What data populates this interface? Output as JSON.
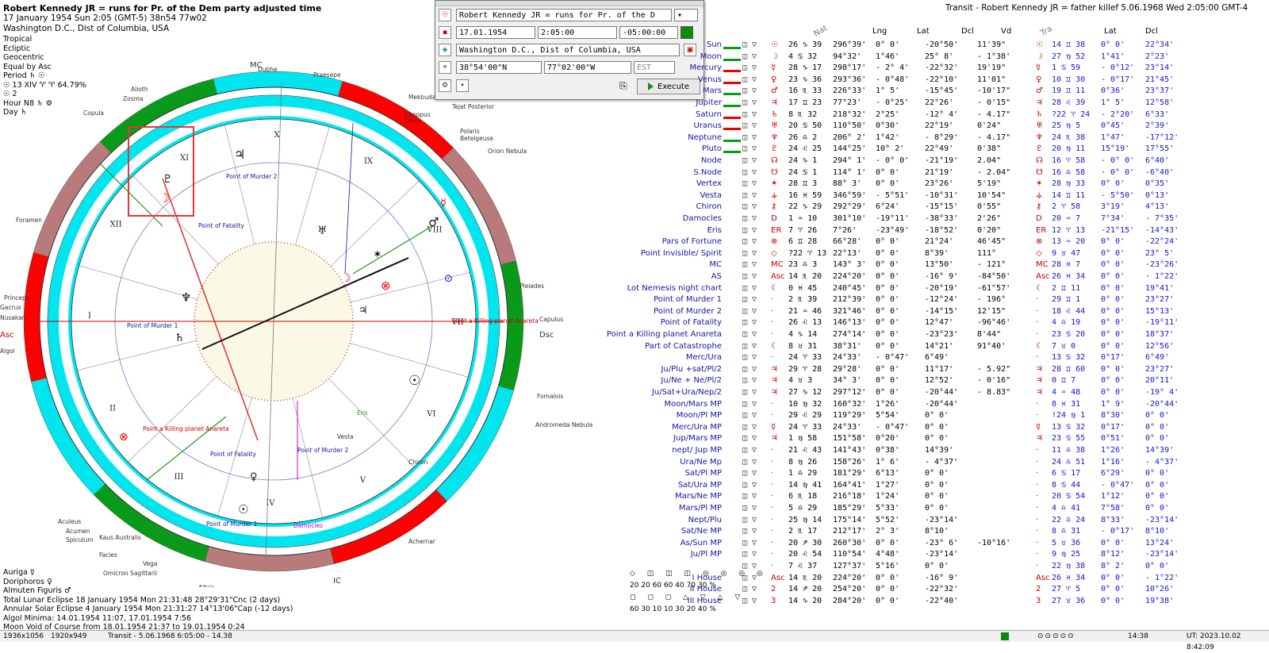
{
  "chart_header": {
    "title": "Robert Kennedy JR = runs for Pr. of the Dem party adjusted time",
    "datetime": "17 January 1954  Sun   2:05 (GMT-5) 38n54  77w02",
    "place": "Washington D.C., Dist of Columbia, USA"
  },
  "settings": [
    "Tropical",
    "Ecliptic",
    "Geocentric",
    "Equal by Asc",
    "Period ♄ ☉",
    "☉ 13 XIV ♈ ♈ 64.79%",
    "☉  2",
    "Hour N8 ♄ ⚙",
    "Day ♄"
  ],
  "transit_title": "Transit - Robert Kennedy JR = father killef  5.06.1968  Wed  2:05:00 GMT-4",
  "dialog": {
    "name_value": "Robert Kennedy JR = runs for Pr. of the D",
    "date_value": "17.01.1954",
    "time_value": "2:05:00",
    "offset_value": "-05:00:00",
    "place_value": "Washington D.C., Dist of Columbia, USA",
    "lat_value": "38°54'00\"N",
    "lon_value": "77°02'00\"W",
    "tz_value": "EST",
    "execute_label": "Execute"
  },
  "wheel": {
    "angles": {
      "mc": "MC",
      "ic": "IC",
      "asc": "Asc",
      "dsc": "Dsc"
    },
    "houses": [
      "I",
      "II",
      "III",
      "IV",
      "V",
      "VI",
      "VII",
      "VIII",
      "IX",
      "X",
      "XI",
      "XII"
    ],
    "labels": [
      "Point of Murder 2",
      "Point of Fatality",
      "Point of Murder 1",
      "Point a Killing planet Anareta",
      "Point a Killing planet Anareta",
      "Point of Murder 1",
      "Point of Murder 2",
      "Point of Fatality",
      "Damocles",
      "Vesta",
      "Chiron",
      "Eris",
      "Praesepe",
      "Polaris",
      "Betelgeuse",
      "Orion Nebula",
      "Tejat Posterior",
      "Pleiades",
      "Capulus",
      "Fomalois",
      "Andromeda Nebula",
      "Achernar",
      "Altair",
      "Vega",
      "Omicron Sagittarii",
      "Facies",
      "Kaus Australis",
      "Aculeus",
      "Acumen",
      "Spiculum",
      "Foramen",
      "Princeps",
      "Gacrux",
      "Nusakan",
      "Copula",
      "Zosma",
      "Alioth",
      "Dubhe",
      "Mekbuda",
      "Canopus",
      "Sirius",
      "Algol"
    ]
  },
  "table": {
    "headers": {
      "nat": "Nat",
      "lng": "Lng",
      "lat": "Lat",
      "dcl": "Dcl",
      "vd": "Vd",
      "tra": "Tra",
      "tlat": "Lat",
      "tdcl": "Dcl"
    },
    "rows": [
      {
        "name": "Sun",
        "sym": "☉",
        "pos": "26 ♑ 39",
        "lng": "296°39'",
        "lat": "0° 0'",
        "dcl": "-20°50'",
        "vd": "11'39\"",
        "tsym": "☉",
        "tpos": "14 ♊ 38",
        "tlat": "0° 0'",
        "tdcl": "22°34'"
      },
      {
        "name": "Moon",
        "sym": "☽",
        "pos": "4 ♋ 32",
        "lng": "94°32'",
        "lat": "1°46'",
        "dcl": "25° 8'",
        "vd": "- 1°38'",
        "tsym": "☽",
        "tpos": "27 ♍ 52",
        "tlat": "1°41'",
        "tdcl": "2°23'"
      },
      {
        "name": "Mercury",
        "sym": "☿",
        "pos": "28 ♑ 17",
        "lng": "298°17'",
        "lat": "- 2° 4'",
        "dcl": "-22°32'",
        "vd": "19'19\"",
        "tsym": "☿",
        "tpos": "1 ♋ 59",
        "tlat": "- 0°12'",
        "tdcl": "23°14'"
      },
      {
        "name": "Venus",
        "sym": "♀",
        "pos": "23 ♑ 36",
        "lng": "293°36'",
        "lat": "- 0°48'",
        "dcl": "-22°10'",
        "vd": "11'01\"",
        "tsym": "♀",
        "tpos": "10 ♊ 30",
        "tlat": "- 0°17'",
        "tdcl": "21°45'"
      },
      {
        "name": "Mars",
        "sym": "♂",
        "pos": "16 ♏ 33",
        "lng": "226°33'",
        "lat": "1° 5'",
        "dcl": "-15°45'",
        "vd": "-10'17\"",
        "tsym": "♂",
        "tpos": "19 ♊ 11",
        "tlat": "0°36'",
        "tdcl": "23°37'"
      },
      {
        "name": "Jupiter",
        "sym": "♃",
        "pos": "17 ♊ 23",
        "lng": "77°23'",
        "lat": "- 0°25'",
        "dcl": "22°26'",
        "vd": "- 0'15\"",
        "tsym": "♃",
        "tpos": "28 ♌ 39",
        "tlat": "1° 5'",
        "tdcl": "12°58'"
      },
      {
        "name": "Saturn",
        "sym": "♄",
        "pos": "8 ♏ 32",
        "lng": "218°32'",
        "lat": "2°25'",
        "dcl": "-12° 4'",
        "vd": "- 4.17\"",
        "tsym": "♄",
        "tpos": "?22 ♈ 24",
        "tlat": "- 2°20'",
        "tdcl": "6°33'"
      },
      {
        "name": "Uranus",
        "sym": "♅",
        "pos": "20 ♋ 50",
        "lng": "110°50'",
        "lat": "0°30'",
        "dcl": "22°19'",
        "vd": "0'24\"",
        "tsym": "♅",
        "tpos": "25 ♍ 5",
        "tlat": "0°45'",
        "tdcl": "2°39'"
      },
      {
        "name": "Neptune",
        "sym": "♆",
        "pos": "26 ♎ 2",
        "lng": "206° 2'",
        "lat": "1°42'",
        "dcl": "- 8°29'",
        "vd": "- 4.17\"",
        "tsym": "♆",
        "tpos": "24 ♏ 38",
        "tlat": "1°47'",
        "tdcl": "-17°12'"
      },
      {
        "name": "Pluto",
        "sym": "♇",
        "pos": "24 ♌ 25",
        "lng": "144°25'",
        "lat": "10° 2'",
        "dcl": "22°49'",
        "vd": "0'38\"",
        "tsym": "♇",
        "tpos": "20 ♍ 11",
        "tlat": "15°19'",
        "tdcl": "17°55'"
      },
      {
        "name": "Node",
        "sym": "☊",
        "pos": "24 ♑ 1",
        "lng": "294° 1'",
        "lat": "- 0° 0'",
        "dcl": "-21°19'",
        "vd": "2.04\"",
        "tsym": "☊",
        "tpos": "16 ♈ 58",
        "tlat": "- 0° 0'",
        "tdcl": "6°40'"
      },
      {
        "name": "S.Node",
        "sym": "☋",
        "pos": "24 ♋ 1",
        "lng": "114° 1'",
        "lat": "0° 0'",
        "dcl": "21°19'",
        "vd": "- 2.04\"",
        "tsym": "☋",
        "tpos": "16 ♎ 58",
        "tlat": "- 0° 0'",
        "tdcl": "-6°40'"
      },
      {
        "name": "Vertex",
        "sym": "✶",
        "pos": "28 ♊ 3",
        "lng": "88° 3'",
        "lat": "0° 0'",
        "dcl": "23°26'",
        "vd": "5'19\"",
        "tsym": "✶",
        "tpos": "28 ♍ 33",
        "tlat": "0° 0'",
        "tdcl": "0°35'"
      },
      {
        "name": "Vesta",
        "sym": "⚶",
        "pos": "16 ♓ 59",
        "lng": "346°59'",
        "lat": "- 5°51'",
        "dcl": "-10°31'",
        "vd": "10'54\"",
        "tsym": "⚶",
        "tpos": "14 ♊ 11",
        "tlat": "- 5°50'",
        "tdcl": "0°13'"
      },
      {
        "name": "Chiron",
        "sym": "⚷",
        "pos": "22 ♑ 29",
        "lng": "292°29'",
        "lat": "6°24'",
        "dcl": "-15°15'",
        "vd": "0'55\"",
        "tsym": "⚷",
        "tpos": "2 ♈ 58",
        "tlat": "3°19'",
        "tdcl": "4°13'"
      },
      {
        "name": "Damocles",
        "sym": "D",
        "pos": "1 ♒ 10",
        "lng": "301°10'",
        "lat": "-19°11'",
        "dcl": "-38°33'",
        "vd": "2'26\"",
        "tsym": "D",
        "tpos": "20 ♒ 7",
        "tlat": "7°34'",
        "tdcl": "- 7°35'"
      },
      {
        "name": "Eris",
        "sym": "ER",
        "pos": "7 ♈ 26",
        "lng": "7°26'",
        "lat": "-23°49'",
        "dcl": "-18°52'",
        "vd": "0'20\"",
        "tsym": "ER",
        "tpos": "12 ♈ 13",
        "tlat": "-21°15'",
        "tdcl": "-14°43'"
      },
      {
        "name": "Pars of Fortune",
        "sym": "⊗",
        "pos": "6 ♊ 28",
        "lng": "66°28'",
        "lat": "0° 0'",
        "dcl": "21°24'",
        "vd": "46'45\"",
        "tsym": "⊗",
        "tpos": "13 ♒ 20",
        "tlat": "0° 0'",
        "tdcl": "-22°24'"
      },
      {
        "name": "Point Invisible/ Spirit",
        "sym": "◇",
        "pos": "?22 ♈ 13",
        "lng": "22°13'",
        "lat": "0° 0'",
        "dcl": "8°39'",
        "vd": "111°",
        "tsym": "◇",
        "tpos": "9 ♉ 47",
        "tlat": "0° 0'",
        "tdcl": "23° 5'"
      },
      {
        "name": "MC",
        "sym": "MC",
        "pos": "23 ♎ 3",
        "lng": "143° 3'",
        "lat": "0° 0'",
        "dcl": "13°50'",
        "vd": "- 121°",
        "tsym": "MC",
        "tpos": "28 ♓ 7",
        "tlat": "0° 0'",
        "tdcl": "-23°26'"
      },
      {
        "name": "AS",
        "sym": "Asc",
        "pos": "14 ♏ 20",
        "lng": "224°20'",
        "lat": "0° 0'",
        "dcl": "-16° 9'",
        "vd": "-84°50'",
        "tsym": "Asc",
        "tpos": "26 ♓ 34",
        "tlat": "0° 0'",
        "tdcl": "- 1°22'"
      },
      {
        "name": "Lot Nemesis night chart",
        "sym": "☾",
        "pos": "0 ♓ 45",
        "lng": "240°45'",
        "lat": "0° 0'",
        "dcl": "-20°19'",
        "vd": "-61°57'",
        "tsym": "☾",
        "tpos": "2 ♊ 11",
        "tlat": "0° 0'",
        "tdcl": "19°41'"
      },
      {
        "name": "Point of Murder 1",
        "sym": "·",
        "pos": "2 ♏ 39",
        "lng": "212°39'",
        "lat": "0° 0'",
        "dcl": "-12°24'",
        "vd": "- 196°",
        "tsym": "·",
        "tpos": "29 ♊ 1",
        "tlat": "0° 0'",
        "tdcl": "23°27'"
      },
      {
        "name": "Point of Murder 2",
        "sym": "·",
        "pos": "21 ♒ 46",
        "lng": "321°46'",
        "lat": "0° 0'",
        "dcl": "-14°15'",
        "vd": "12'15\"",
        "tsym": "·",
        "tpos": "18 ♌ 44",
        "tlat": "0° 0'",
        "tdcl": "15°13'"
      },
      {
        "name": "Point of Fatality",
        "sym": "·",
        "pos": "26 ♌ 13",
        "lng": "146°13'",
        "lat": "0° 0'",
        "dcl": "12°47'",
        "vd": "-96°46'",
        "tsym": "·",
        "tpos": "4 ♎ 19",
        "tlat": "0° 0'",
        "tdcl": "-19°11'"
      },
      {
        "name": "Point a Killing planet Anareta",
        "sym": "·",
        "pos": "4 ♑ 14",
        "lng": "274°14'",
        "lat": "0° 0'",
        "dcl": "-23°23'",
        "vd": "8'44\"",
        "tsym": "·",
        "tpos": "23 ♋ 20",
        "tlat": "0° 0'",
        "tdcl": "18°37'"
      },
      {
        "name": "Part of Catastrophe",
        "sym": "☾",
        "pos": "8 ♉ 31",
        "lng": "38°31'",
        "lat": "0° 0'",
        "dcl": "14°21'",
        "vd": "91°40'",
        "tsym": "☾",
        "tpos": "7 ♉ 0",
        "tlat": "0° 0'",
        "tdcl": "12°56'"
      },
      {
        "name": "Merc/Ura",
        "sym": "·",
        "pos": "24 ♈ 33",
        "lng": "24°33'",
        "lat": "- 0°47'",
        "dcl": "6°49'",
        "vd": "",
        "tsym": "·",
        "tpos": "13 ♋ 32",
        "tlat": "0°17'",
        "tdcl": "6°49'"
      },
      {
        "name": "Ju/Plu +sat/Pl/2",
        "sym": "♃",
        "pos": "29 ♈ 28",
        "lng": "29°28'",
        "lat": "0° 0'",
        "dcl": "11°17'",
        "vd": "- 5.92\"",
        "tsym": "♃",
        "tpos": "28 ♊ 60",
        "tlat": "0° 0'",
        "tdcl": "23°27'"
      },
      {
        "name": "Ju/Ne + Ne/Pl/2",
        "sym": "♃",
        "pos": "4 ♉ 3",
        "lng": "34° 3'",
        "lat": "0° 0'",
        "dcl": "12°52'",
        "vd": "- 0'16\"",
        "tsym": "♃",
        "tpos": "0 ♊ 7",
        "tlat": "0° 0'",
        "tdcl": "20°11'"
      },
      {
        "name": "Ju/Sat+Ura/Nep/2",
        "sym": "♃",
        "pos": "27 ♑ 12",
        "lng": "297°12'",
        "lat": "0° 0'",
        "dcl": "-20°44'",
        "vd": "- 8.83\"",
        "tsym": "♃",
        "tpos": "4 ♒ 48",
        "tlat": "0° 0'",
        "tdcl": "-19° 4'"
      },
      {
        "name": "Moon/Mars MP",
        "sym": "·",
        "pos": "10 ♍ 32",
        "lng": "160°32'",
        "lat": "1°26'",
        "dcl": "-20°44'",
        "vd": "",
        "tsym": "·",
        "tpos": "8 ♓ 31",
        "tlat": "1° 9'",
        "tdcl": "-20°44'"
      },
      {
        "name": "Moon/Pl MP",
        "sym": "·",
        "pos": "29 ♌ 29",
        "lng": "119°29'",
        "lat": "5°54'",
        "dcl": "0° 0'",
        "vd": "",
        "tsym": "·",
        "tpos": "!24 ♍ 1",
        "tlat": "8°30'",
        "tdcl": "0° 0'"
      },
      {
        "name": "Merc/Ura MP",
        "sym": "☿",
        "pos": "24 ♈ 33",
        "lng": "24°33'",
        "lat": "- 0°47'",
        "dcl": "0° 0'",
        "vd": "",
        "tsym": "☿",
        "tpos": "13 ♋ 32",
        "tlat": "0°17'",
        "tdcl": "0° 0'"
      },
      {
        "name": "Jup/Mars MP",
        "sym": "♃",
        "pos": "1 ♍ 58",
        "lng": "151°58'",
        "lat": "0°20'",
        "dcl": "0° 0'",
        "vd": "",
        "tsym": "♃",
        "tpos": "23 ♋ 55",
        "tlat": "0°51'",
        "tdcl": "0° 0'"
      },
      {
        "name": "nept/ Jup MP",
        "sym": "·",
        "pos": "21 ♌ 43",
        "lng": "141°43'",
        "lat": "0°38'",
        "dcl": "14°39'",
        "vd": "",
        "tsym": "·",
        "tpos": "11 ♎ 38",
        "tlat": "1°26'",
        "tdcl": "14°39'"
      },
      {
        "name": "Ura/Ne Mp",
        "sym": "·",
        "pos": "8 ♍ 26",
        "lng": "158°26'",
        "lat": "1° 6'",
        "dcl": "- 4°37'",
        "vd": "",
        "tsym": "·",
        "tpos": "24 ♎ 51",
        "tlat": "1°16'",
        "tdcl": "- 4°37'"
      },
      {
        "name": "Sat/Pl MP",
        "sym": "·",
        "pos": "1 ♎ 29",
        "lng": "181°29'",
        "lat": "6°13'",
        "dcl": "0° 0'",
        "vd": "",
        "tsym": "·",
        "tpos": "6 ♋ 17",
        "tlat": "6°29'",
        "tdcl": "0° 0'"
      },
      {
        "name": "Sat/Ura MP",
        "sym": "·",
        "pos": "14 ♍ 41",
        "lng": "164°41'",
        "lat": "1°27'",
        "dcl": "0° 0'",
        "vd": "",
        "tsym": "·",
        "tpos": "8 ♋ 44",
        "tlat": "- 0°47'",
        "tdcl": "0° 0'"
      },
      {
        "name": "Mars/Ne MP",
        "sym": "·",
        "pos": "6 ♏ 18",
        "lng": "216°18'",
        "lat": "1°24'",
        "dcl": "0° 0'",
        "vd": "",
        "tsym": "·",
        "tpos": "20 ♋ 54",
        "tlat": "1°12'",
        "tdcl": "0° 0'"
      },
      {
        "name": "Mars/Pl MP",
        "sym": "·",
        "pos": "5 ♎ 29",
        "lng": "185°29'",
        "lat": "5°33'",
        "dcl": "0° 0'",
        "vd": "",
        "tsym": "·",
        "tpos": "4 ♎ 41",
        "tlat": "7°58'",
        "tdcl": "0° 0'"
      },
      {
        "name": "Nept/Plu",
        "sym": "·",
        "pos": "25 ♍ 14",
        "lng": "175°14'",
        "lat": "5°52'",
        "dcl": "-23°14'",
        "vd": "",
        "tsym": "·",
        "tpos": "22 ♎ 24",
        "tlat": "8°33'",
        "tdcl": "-23°14'"
      },
      {
        "name": "Sat/Ne MP",
        "sym": "·",
        "pos": "2 ♏ 17",
        "lng": "212°17'",
        "lat": "2° 3'",
        "dcl": "8°10'",
        "vd": "",
        "tsym": "·",
        "tpos": "8 ♎ 31",
        "tlat": "- 0°17'",
        "tdcl": "8°10'"
      },
      {
        "name": "As/Sun MP",
        "sym": "·",
        "pos": "20 ♐ 30",
        "lng": "260°30'",
        "lat": "0° 0'",
        "dcl": "-23° 6'",
        "vd": "-10°16'",
        "tsym": "·",
        "tpos": "5 ♉ 36",
        "tlat": "0° 0'",
        "tdcl": "13°24'"
      },
      {
        "name": "Ju/Pl MP",
        "sym": "·",
        "pos": "20 ♌ 54",
        "lng": "110°54'",
        "lat": "4°48'",
        "dcl": "-23°14'",
        "vd": "",
        "tsym": "·",
        "tpos": "9 ♍ 25",
        "tlat": "8°12'",
        "tdcl": "-23°14'"
      },
      {
        "name": "",
        "sym": "·",
        "pos": "7 ♌ 37",
        "lng": "127°37'",
        "lat": "5°16'",
        "dcl": "0° 0'",
        "vd": "",
        "tsym": "·",
        "tpos": "22 ♍ 38",
        "tlat": "8° 2'",
        "tdcl": "0° 0'"
      },
      {
        "name": "I House",
        "sym": "Asc",
        "pos": "14 ♏ 20",
        "lng": "224°20'",
        "lat": "0° 0'",
        "dcl": "-16° 9'",
        "vd": "",
        "tsym": "Asc",
        "tpos": "26 ♓ 34",
        "tlat": "0° 0'",
        "tdcl": "- 1°22'"
      },
      {
        "name": "II House",
        "sym": "2",
        "pos": "14 ♐ 20",
        "lng": "254°20'",
        "lat": "0° 0'",
        "dcl": "-22°32'",
        "vd": "",
        "tsym": "2",
        "tpos": "27 ♈ 5",
        "tlat": "0° 0'",
        "tdcl": "10°26'"
      },
      {
        "name": "III House",
        "sym": "3",
        "pos": "14 ♑ 20",
        "lng": "284°20'",
        "lat": "0° 0'",
        "dcl": "-22°40'",
        "vd": "",
        "tsym": "3",
        "tpos": "27 ♉ 36",
        "tlat": "0° 0'",
        "tdcl": "19°38'"
      }
    ]
  },
  "legend": {
    "row1": "20  20  60      60  40  70  30 %",
    "row2": "60  30  10      10  30  20  40 %"
  },
  "bottom_notes": [
    "Auriga ☿",
    "Doriphoros ♀",
    "Almuten Figuris ♂",
    "Total Lunar Eclipse 18 January 1954 Mon 21:31:48 28°29'31\"Cnc (2 days)",
    "Annular Solar Eclipse 4 January 1954 Mon 21:31:27 14°13'06\"Cap (-12 days)",
    "Algol Minima: 14.01.1954 11:07,  17.01.1954  7:56",
    "Moon Void of Course from 18.01.1954 21:37 to 19.01.1954  0:24"
  ],
  "status": {
    "size": "1936x1056",
    "resolution": "1920x949",
    "transit": "Transit - 5.06.1968  6:05:00 - 14.38",
    "time": "14:38",
    "ut": "UT: 2023.10.02  8:42:09"
  },
  "colors": {
    "red": "#ff0000",
    "cyan": "#00e5ee",
    "green": "#0a9a1a",
    "mauve": "#b87a7a",
    "blue_text": "#1515a0"
  }
}
